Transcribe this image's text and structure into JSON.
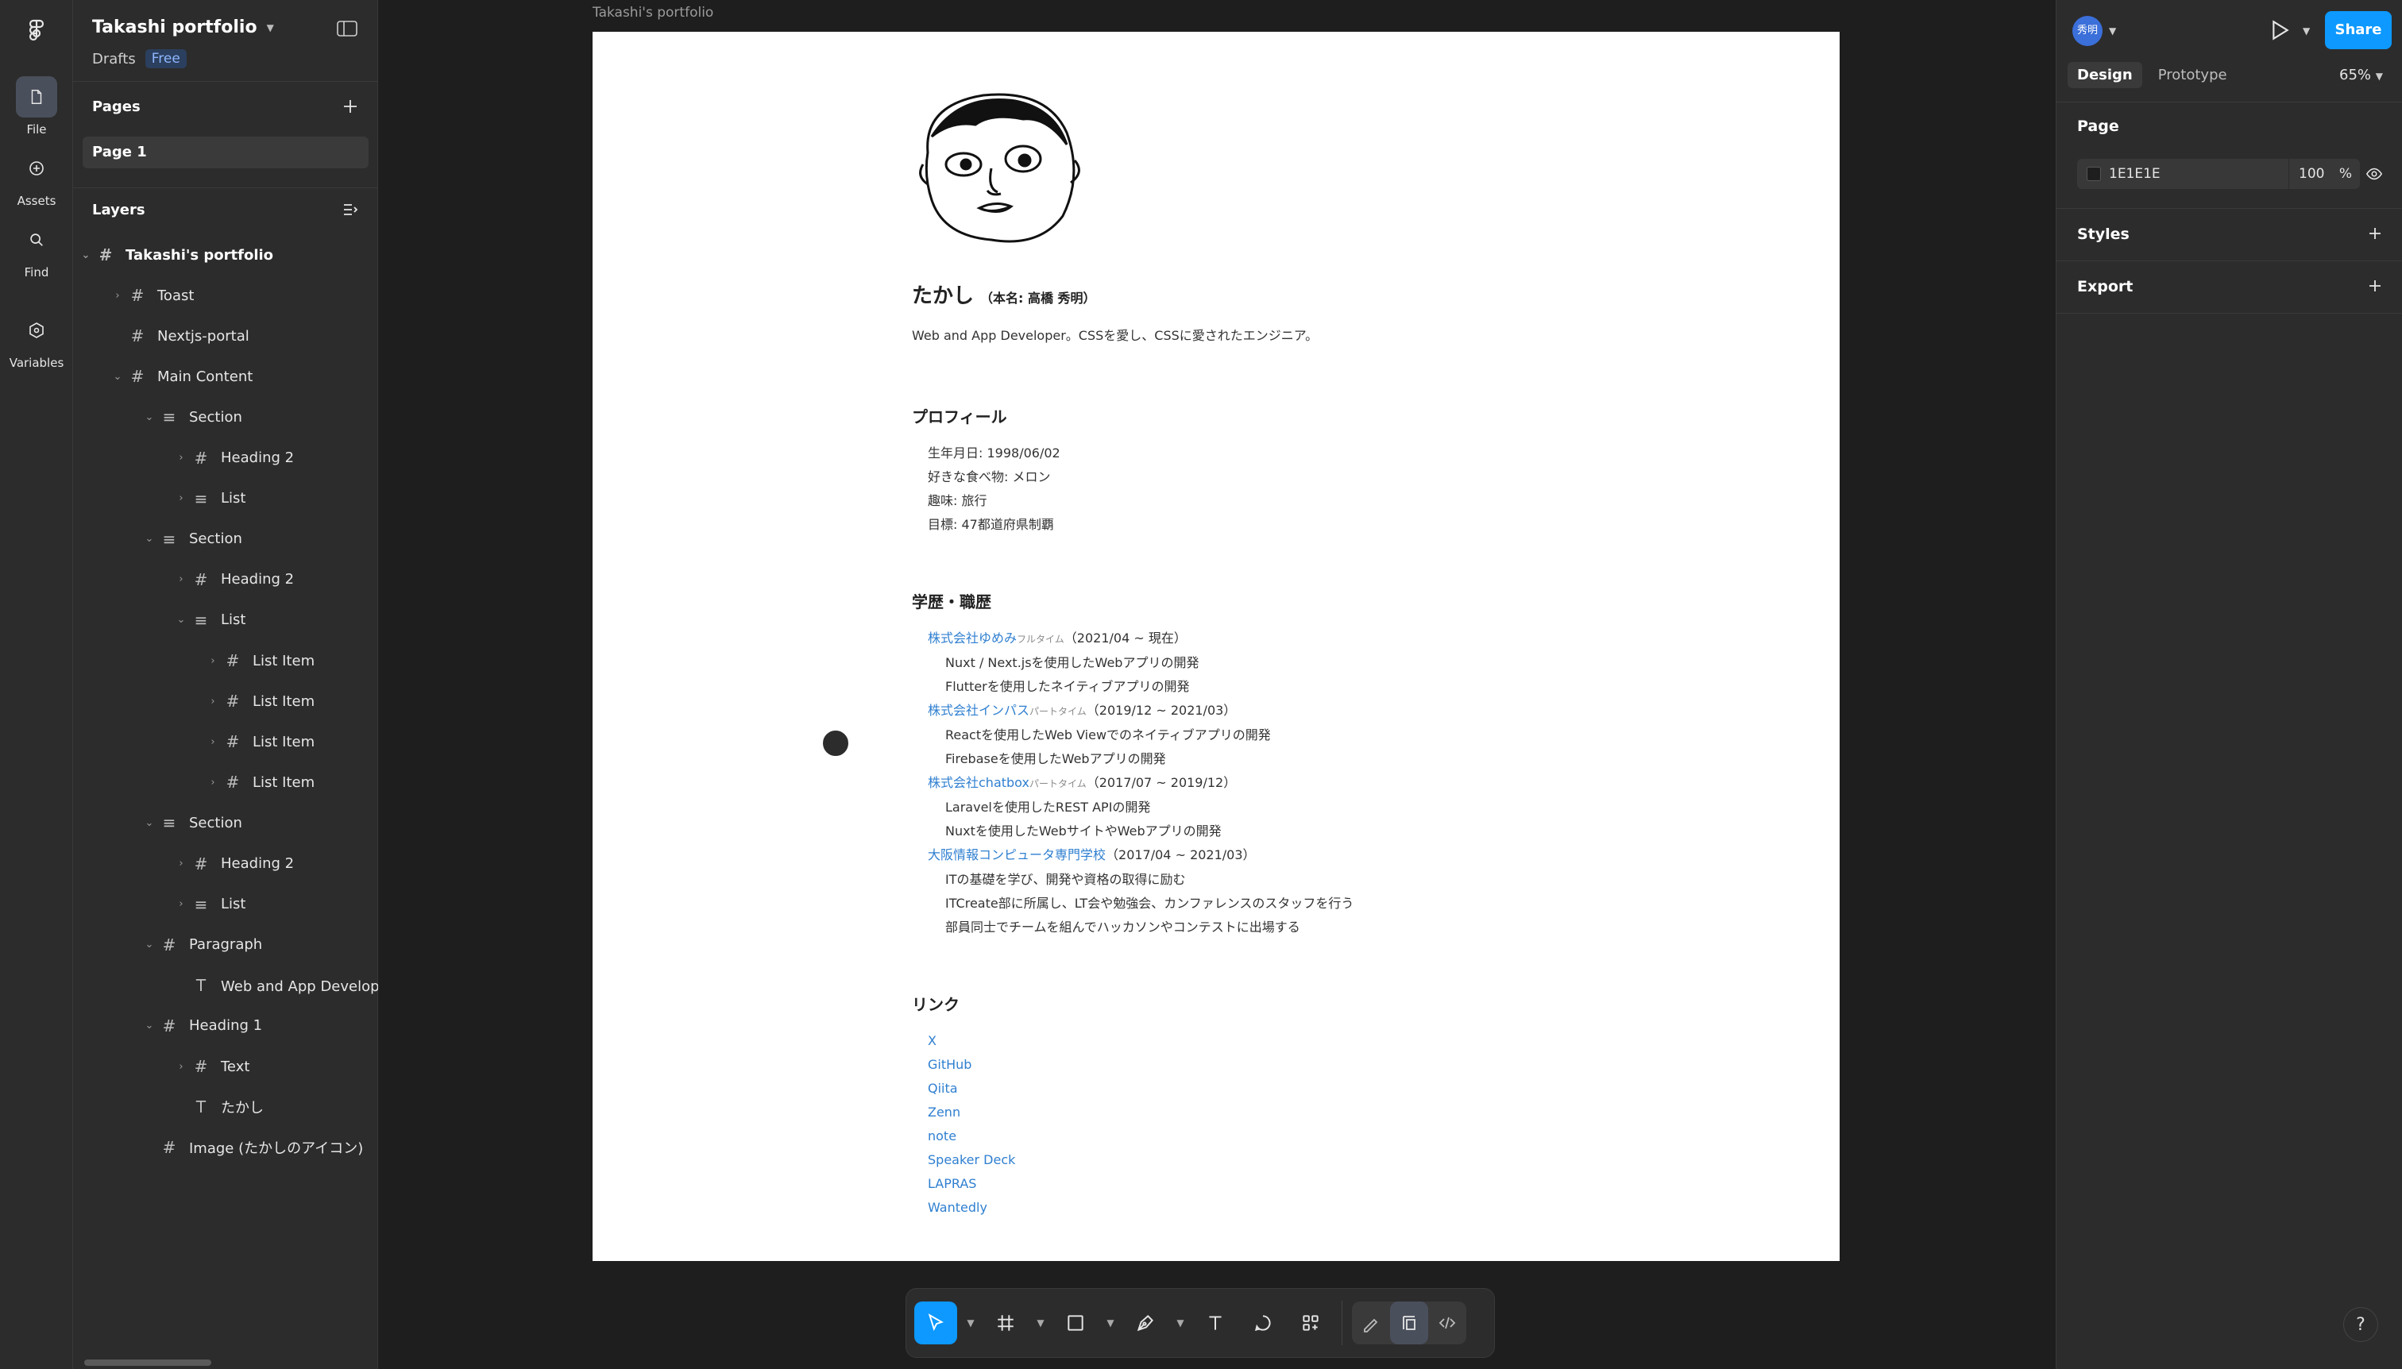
{
  "app": {
    "file_name": "Takashi portfolio",
    "location": "Drafts",
    "plan_badge": "Free"
  },
  "rail": [
    {
      "label": "File",
      "icon": "file-icon",
      "active": true
    },
    {
      "label": "Assets",
      "icon": "assets-icon",
      "active": false
    },
    {
      "label": "Find",
      "icon": "search-icon",
      "active": false
    },
    {
      "label": "Variables",
      "icon": "variables-icon",
      "active": false
    }
  ],
  "pages": {
    "title": "Pages",
    "items": [
      "Page 1"
    ]
  },
  "layers": {
    "title": "Layers",
    "items": [
      {
        "label": "Takashi's portfolio",
        "icon": "frame",
        "chev": "down",
        "depth": 0
      },
      {
        "label": "Toast",
        "icon": "frame",
        "chev": "right",
        "depth": 1
      },
      {
        "label": "Nextjs-portal",
        "icon": "frame",
        "chev": "",
        "depth": 1
      },
      {
        "label": "Main Content",
        "icon": "frame",
        "chev": "down",
        "depth": 1
      },
      {
        "label": "Section",
        "icon": "autolayout",
        "chev": "down",
        "depth": 2
      },
      {
        "label": "Heading 2",
        "icon": "frame",
        "chev": "right",
        "depth": 3
      },
      {
        "label": "List",
        "icon": "autolayout",
        "chev": "right",
        "depth": 3
      },
      {
        "label": "Section",
        "icon": "autolayout",
        "chev": "down",
        "depth": 2
      },
      {
        "label": "Heading 2",
        "icon": "frame",
        "chev": "right",
        "depth": 3
      },
      {
        "label": "List",
        "icon": "autolayout",
        "chev": "down",
        "depth": 3
      },
      {
        "label": "List Item",
        "icon": "frame",
        "chev": "right",
        "depth": 4
      },
      {
        "label": "List Item",
        "icon": "frame",
        "chev": "right",
        "depth": 4
      },
      {
        "label": "List Item",
        "icon": "frame",
        "chev": "right",
        "depth": 4
      },
      {
        "label": "List Item",
        "icon": "frame",
        "chev": "right",
        "depth": 4
      },
      {
        "label": "Section",
        "icon": "autolayout",
        "chev": "down",
        "depth": 2
      },
      {
        "label": "Heading 2",
        "icon": "frame",
        "chev": "right",
        "depth": 3
      },
      {
        "label": "List",
        "icon": "autolayout",
        "chev": "right",
        "depth": 3
      },
      {
        "label": "Paragraph",
        "icon": "frame",
        "chev": "down",
        "depth": 2
      },
      {
        "label": "Web and App Developer。",
        "icon": "text",
        "chev": "",
        "depth": 3
      },
      {
        "label": "Heading 1",
        "icon": "frame",
        "chev": "down",
        "depth": 2
      },
      {
        "label": "Text",
        "icon": "frame",
        "chev": "right",
        "depth": 3
      },
      {
        "label": "たかし",
        "icon": "text",
        "chev": "",
        "depth": 3
      },
      {
        "label": "Image (たかしのアイコン)",
        "icon": "frame",
        "chev": "",
        "depth": 2
      }
    ]
  },
  "canvas": {
    "frame_label": "Takashi's portfolio",
    "name": "たかし",
    "real_name": "（本名: 高橋 秀明）",
    "lead": "Web and App Developer。CSSを愛し、CSSに愛されたエンジニア。",
    "profile": {
      "heading": "プロフィール",
      "items": [
        "生年月日: 1998/06/02",
        "好きな食べ物: メロン",
        "趣味: 旅行",
        "目標: 47都道府県制覇"
      ]
    },
    "career": {
      "heading": "学歴・職歴",
      "jobs": [
        {
          "company": "株式会社ゆめみ",
          "tag": "フルタイム",
          "period": "（2021/04 ~ 現在）",
          "details": [
            "Nuxt / Next.jsを使用したWebアプリの開発",
            "Flutterを使用したネイティブアプリの開発"
          ]
        },
        {
          "company": "株式会社インパス",
          "tag": "パートタイム",
          "period": "（2019/12 ~ 2021/03）",
          "details": [
            "Reactを使用したWeb Viewでのネイティブアプリの開発",
            "Firebaseを使用したWebアプリの開発"
          ]
        },
        {
          "company": "株式会社chatbox",
          "tag": "パートタイム",
          "period": "（2017/07 ~ 2019/12）",
          "details": [
            "Laravelを使用したREST APIの開発",
            "Nuxtを使用したWebサイトやWebアプリの開発"
          ]
        },
        {
          "company": "大阪情報コンピュータ専門学校",
          "tag": "",
          "period": "（2017/04 ~ 2021/03）",
          "details": [
            "ITの基礎を学び、開発や資格の取得に励む",
            "ITCreate部に所属し、LT会や勉強会、カンファレンスのスタッフを行う",
            "部員同士でチームを組んでハッカソンやコンテストに出場する"
          ]
        }
      ]
    },
    "links": {
      "heading": "リンク",
      "items": [
        "X",
        "GitHub",
        "Qiita",
        "Zenn",
        "note",
        "Speaker Deck",
        "LAPRAS",
        "Wantedly"
      ]
    }
  },
  "right": {
    "user_initials": "秀明",
    "share_label": "Share",
    "tabs": [
      "Design",
      "Prototype"
    ],
    "zoom": "65%",
    "page_section": "Page",
    "fill_hex": "1E1E1E",
    "fill_opacity": "100",
    "fill_unit": "%",
    "styles_label": "Styles",
    "export_label": "Export"
  },
  "help": "?",
  "colors": {
    "accent": "#0d99ff",
    "link": "#2f7fd0",
    "canvas_bg": "#1e1e1e",
    "panel": "#2c2c2c"
  }
}
